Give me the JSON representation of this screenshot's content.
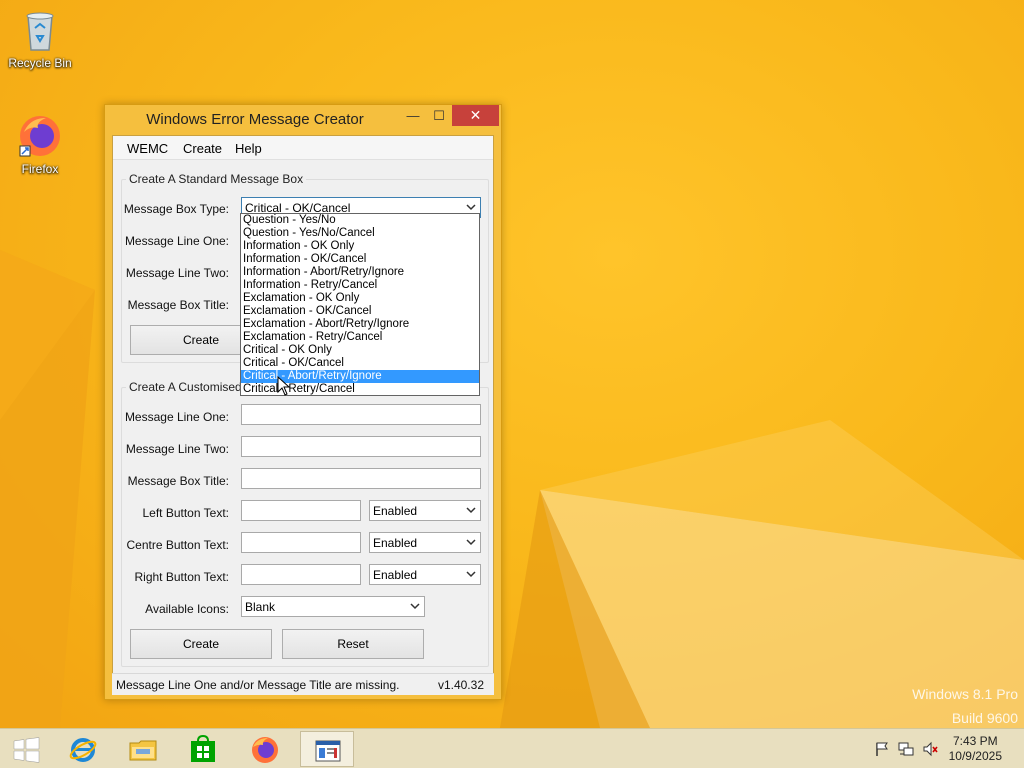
{
  "desktop": {
    "icons": [
      {
        "label": "Recycle Bin",
        "icon": "recycle-bin-icon"
      },
      {
        "label": "Firefox",
        "icon": "firefox-icon"
      }
    ],
    "watermark_line1": "Windows 8.1 Pro",
    "watermark_line2": "Build 9600"
  },
  "window": {
    "title": "Windows Error Message Creator",
    "controls": {
      "minimize": "—",
      "maximize": "☐",
      "close": "✕"
    },
    "menu": [
      "WEMC",
      "Create",
      "Help"
    ],
    "standard": {
      "group_label": "Create A Standard Message Box",
      "type_label": "Message Box Type:",
      "type_value": "Critical - OK/Cancel",
      "line_one_label": "Message Line One:",
      "line_two_label": "Message Line Two:",
      "title_label": "Message Box Title:",
      "create_button": "Create"
    },
    "dropdown_options": [
      "Question - Yes/No",
      "Question - Yes/No/Cancel",
      "Information - OK Only",
      "Information - OK/Cancel",
      "Information - Abort/Retry/Ignore",
      "Information - Retry/Cancel",
      "Exclamation - OK Only",
      "Exclamation - OK/Cancel",
      "Exclamation - Abort/Retry/Ignore",
      "Exclamation - Retry/Cancel",
      "Critical - OK Only",
      "Critical - OK/Cancel",
      "Critical - Abort/Retry/Ignore",
      "Critical - Retry/Cancel"
    ],
    "dropdown_highlighted_index": 12,
    "custom": {
      "group_label": "Create A Customised Message Box",
      "line_one_label": "Message Line One:",
      "line_two_label": "Message Line Two:",
      "title_label": "Message Box Title:",
      "left_label": "Left Button Text:",
      "left_state": "Enabled",
      "centre_label": "Centre Button Text:",
      "centre_state": "Enabled",
      "right_label": "Right Button Text:",
      "right_state": "Enabled",
      "icons_label": "Available Icons:",
      "icons_value": "Blank",
      "create_button": "Create",
      "reset_button": "Reset"
    },
    "status": {
      "message": "Message Line One and/or Message Title are missing.",
      "version": "v1.40.32"
    }
  },
  "taskbar": {
    "apps": [
      {
        "name": "start-button"
      },
      {
        "name": "internet-explorer"
      },
      {
        "name": "file-explorer"
      },
      {
        "name": "store"
      },
      {
        "name": "firefox"
      },
      {
        "name": "wemc-app",
        "active": true
      }
    ],
    "time": "7:43 PM",
    "date": "10/9/2025"
  },
  "colors": {
    "wallpaper": "#f9b81b",
    "selection": "#3399ff",
    "close_button": "#c7413b"
  }
}
